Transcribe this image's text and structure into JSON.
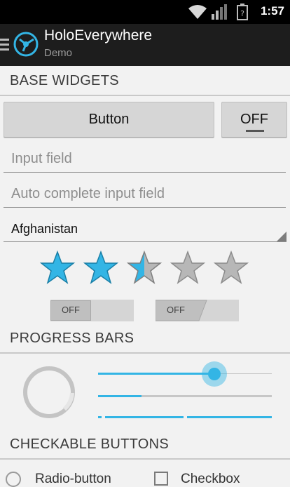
{
  "status_bar": {
    "time": "1:57"
  },
  "action_bar": {
    "title": "HoloEverywhere",
    "subtitle": "Demo"
  },
  "sections": {
    "base_widgets": "BASE WIDGETS",
    "progress_bars": "PROGRESS BARS",
    "checkable_buttons": "CHECKABLE BUTTONS"
  },
  "base_widgets": {
    "button_label": "Button",
    "toggle_button_label": "OFF",
    "input_placeholder": "Input field",
    "autocomplete_placeholder": "Auto complete input field",
    "spinner_selected": "Afghanistan",
    "rating": {
      "value": 2.5,
      "max": 5
    },
    "switches": [
      {
        "label": "OFF"
      },
      {
        "label": "OFF"
      }
    ]
  },
  "progress": {
    "circular_indeterminate": true,
    "seekbar_value": 0.67,
    "horizontal_progress": 0.25,
    "secondary_bar": "indeterminate"
  },
  "checkables": {
    "radio_label": "Radio-button",
    "checkbox_label": "Checkbox"
  },
  "colors": {
    "accent": "#33b5e5",
    "action_bar": "#1d1d1d",
    "background": "#f2f2f2"
  }
}
